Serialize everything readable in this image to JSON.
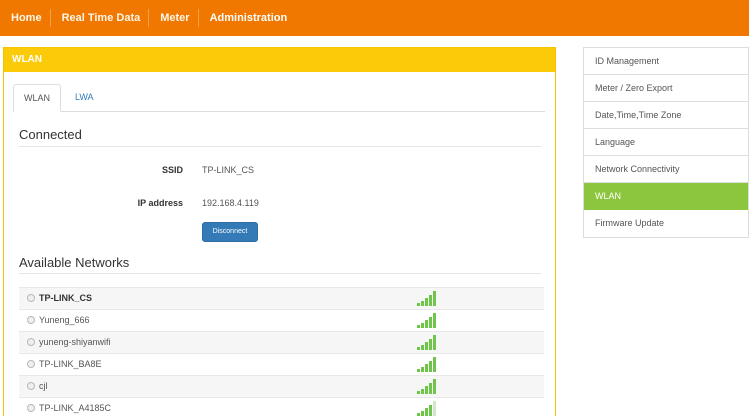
{
  "topnav": {
    "items": [
      {
        "label": "Home"
      },
      {
        "label": "Real Time Data"
      },
      {
        "label": "Meter"
      },
      {
        "label": "Administration"
      }
    ],
    "active_item": "Administration",
    "bar_color": "#f07800"
  },
  "panel": {
    "heading": "WLAN",
    "heading_color": "#fbcb0a",
    "tabs": [
      {
        "label": "WLAN",
        "active": true
      },
      {
        "label": "LWA",
        "active": false
      }
    ]
  },
  "connected": {
    "title": "Connected",
    "ssid_label": "SSID",
    "ssid_value": "TP-LINK_CS",
    "ip_label": "IP address",
    "ip_value": "192.168.4.119",
    "disconnect_label": "Disconnect"
  },
  "available": {
    "title": "Available Networks",
    "networks": [
      {
        "name": "TP-LINK_CS",
        "signal_bars": 5,
        "highlight": true
      },
      {
        "name": "Yuneng_666",
        "signal_bars": 5
      },
      {
        "name": "yuneng-shiyanwifi",
        "signal_bars": 5
      },
      {
        "name": "TP-LINK_BA8E",
        "signal_bars": 5
      },
      {
        "name": "cjl",
        "signal_bars": 5
      },
      {
        "name": "TP-LINK_A4185C",
        "signal_bars": 4
      }
    ],
    "signal_icon": "wifi-signal-icon",
    "signal_color": "#6fc44a"
  },
  "sidebar": {
    "items": [
      {
        "label": "ID Management"
      },
      {
        "label": "Meter / Zero Export"
      },
      {
        "label": "Date,Time,Time Zone"
      },
      {
        "label": "Language"
      },
      {
        "label": "Network Connectivity"
      },
      {
        "label": "WLAN"
      },
      {
        "label": "Firmware Update"
      }
    ],
    "active_item": "WLAN",
    "active_color": "#8cc63e"
  }
}
